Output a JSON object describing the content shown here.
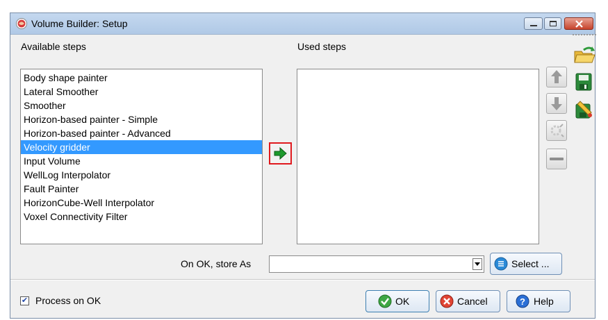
{
  "window": {
    "title": "Volume Builder: Setup"
  },
  "available": {
    "label": "Available steps",
    "items": [
      "Body shape painter",
      "Lateral Smoother",
      "Smoother",
      "Horizon-based painter - Simple",
      "Horizon-based painter - Advanced",
      "Velocity gridder",
      "Input Volume",
      "WellLog Interpolator",
      "Fault Painter",
      "HorizonCube-Well Interpolator",
      "Voxel Connectivity Filter"
    ],
    "selected_index": 5
  },
  "used": {
    "label": "Used steps",
    "items": []
  },
  "store": {
    "label": "On OK, store As",
    "value": "",
    "select_label": "Select ..."
  },
  "process": {
    "label": "Process on OK",
    "checked": true
  },
  "buttons": {
    "ok": "OK",
    "cancel": "Cancel",
    "help": "Help"
  },
  "icons": {
    "app": "app-icon",
    "add": "right-arrow-icon",
    "up": "up-arrow-icon",
    "down": "down-arrow-icon",
    "edit": "edit-step-icon",
    "remove": "remove-icon",
    "open": "open-folder-icon",
    "save": "save-icon",
    "saveas": "save-as-icon"
  },
  "colors": {
    "selection": "#3399ff",
    "highlight_border": "#e0191e",
    "arrow_green": "#1e9a2e"
  }
}
